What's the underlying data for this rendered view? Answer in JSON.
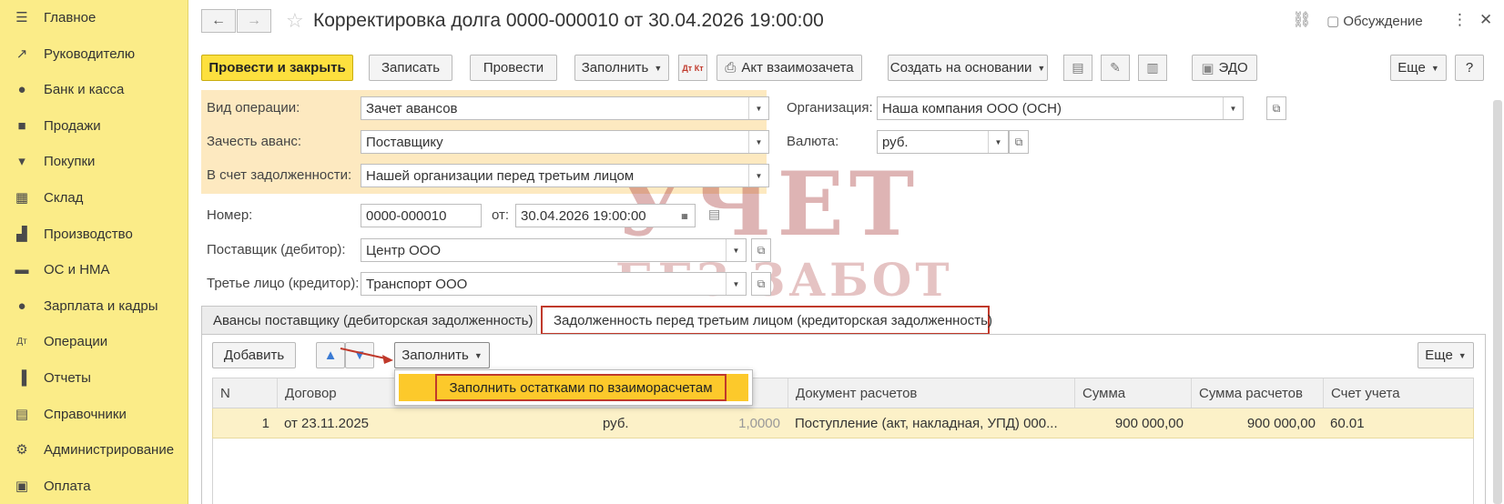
{
  "sidebar": {
    "items": [
      {
        "label": "Главное",
        "icon": "menu-lines-icon"
      },
      {
        "label": "Руководителю",
        "icon": "trend-icon"
      },
      {
        "label": "Банк и касса",
        "icon": "coin-icon"
      },
      {
        "label": "Продажи",
        "icon": "shopping-bag-icon"
      },
      {
        "label": "Покупки",
        "icon": "cart-icon"
      },
      {
        "label": "Склад",
        "icon": "warehouse-icon"
      },
      {
        "label": "Производство",
        "icon": "factory-icon"
      },
      {
        "label": "ОС и НМА",
        "icon": "truck-icon"
      },
      {
        "label": "Зарплата и кадры",
        "icon": "person-icon"
      },
      {
        "label": "Операции",
        "icon": "dt-kt-icon"
      },
      {
        "label": "Отчеты",
        "icon": "bar-chart-icon"
      },
      {
        "label": "Справочники",
        "icon": "books-icon"
      },
      {
        "label": "Администрирование",
        "icon": "gear-icon"
      },
      {
        "label": "Оплата",
        "icon": "payment-icon"
      }
    ]
  },
  "header": {
    "title": "Корректировка долга 0000-000010 от 30.04.2026 19:00:00",
    "discussion": "Обсуждение",
    "back_icon": "←",
    "forward_icon": "→",
    "star_icon": "☆",
    "link_icon": "🔗",
    "more_icon": "⋮",
    "close_icon": "✕"
  },
  "toolbar": {
    "post_close": "Провести и закрыть",
    "save": "Записать",
    "post": "Провести",
    "fill": "Заполнить",
    "dtkt": "Дт Кт",
    "netting_act": "Акт взаимозачета",
    "create_based": "Создать на основании",
    "edo": "ЭДО",
    "more": "Еще",
    "help": "?"
  },
  "form": {
    "operation_type_label": "Вид операции:",
    "operation_type_value": "Зачет авансов",
    "offset_advance_label": "Зачесть аванс:",
    "offset_advance_value": "Поставщику",
    "debt_label": "В счет задолженности:",
    "debt_value": "Нашей организации перед третьим лицом",
    "organization_label": "Организация:",
    "organization_value": "Наша компания ООО (ОСН)",
    "currency_label": "Валюта:",
    "currency_value": "руб.",
    "number_label": "Номер:",
    "number_value": "0000-000010",
    "date_label": "от:",
    "date_value": "30.04.2026 19:00:00",
    "supplier_label": "Поставщик (дебитор):",
    "supplier_value": "Центр ООО",
    "third_party_label": "Третье лицо (кредитор):",
    "third_party_value": "Транспорт ООО"
  },
  "tabs": [
    {
      "label": "Авансы поставщику (дебиторская задолженность)"
    },
    {
      "label": "Задолженность перед третьим лицом (кредиторская задолженность)"
    }
  ],
  "panel": {
    "add": "Добавить",
    "fill": "Заполнить",
    "more": "Еще",
    "menu_item": "Заполнить остатками по взаиморасчетам"
  },
  "table": {
    "columns": [
      "N",
      "Договор",
      "Документ расчетов",
      "Сумма",
      "Сумма расчетов",
      "Счет учета"
    ],
    "rows": [
      {
        "n": "1",
        "contract": "от 23.11.2025",
        "currency": "руб.",
        "rate": "1,0000",
        "document": "Поступление (акт, накладная, УПД) 000...",
        "sum": "900 000,00",
        "settlement_sum": "900 000,00",
        "account": "60.01"
      }
    ]
  },
  "watermark": {
    "line1": "УЧЕТ",
    "line2": "БЕЗ ЗАБОТ"
  },
  "colors": {
    "sidebar_bg": "#fbec88",
    "primary_button": "#fde03e",
    "highlight_row": "#fcf1c8",
    "highlight_menu": "#fcc92b",
    "annotation_red": "#c0392b"
  }
}
